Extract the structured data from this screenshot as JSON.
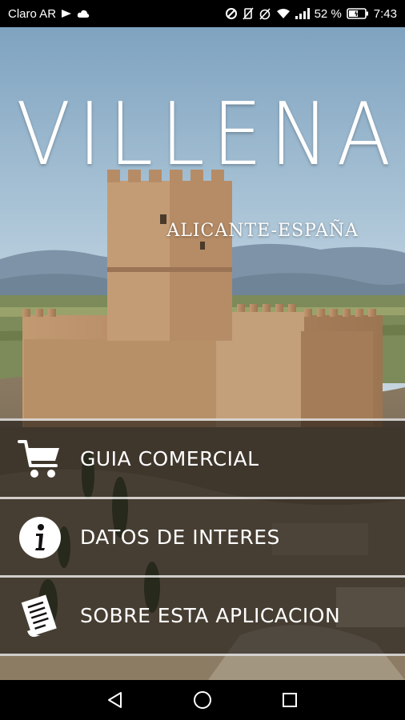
{
  "status_bar": {
    "carrier": "Claro AR",
    "battery": "52 %",
    "time": "7:43"
  },
  "header": {
    "title": "VILLENA",
    "subtitle": "ALICANTE-ESPAÑA"
  },
  "menu": {
    "items": [
      {
        "label": "GUIA COMERCIAL",
        "icon": "shopping-cart-icon"
      },
      {
        "label": "DATOS DE INTERES",
        "icon": "info-icon"
      },
      {
        "label": "SOBRE ESTA APLICACION",
        "icon": "document-icon"
      }
    ]
  },
  "colors": {
    "overlay": "#141210",
    "text": "#ffffff",
    "sky": "#a9c3d6",
    "stone": "#b48a64"
  }
}
